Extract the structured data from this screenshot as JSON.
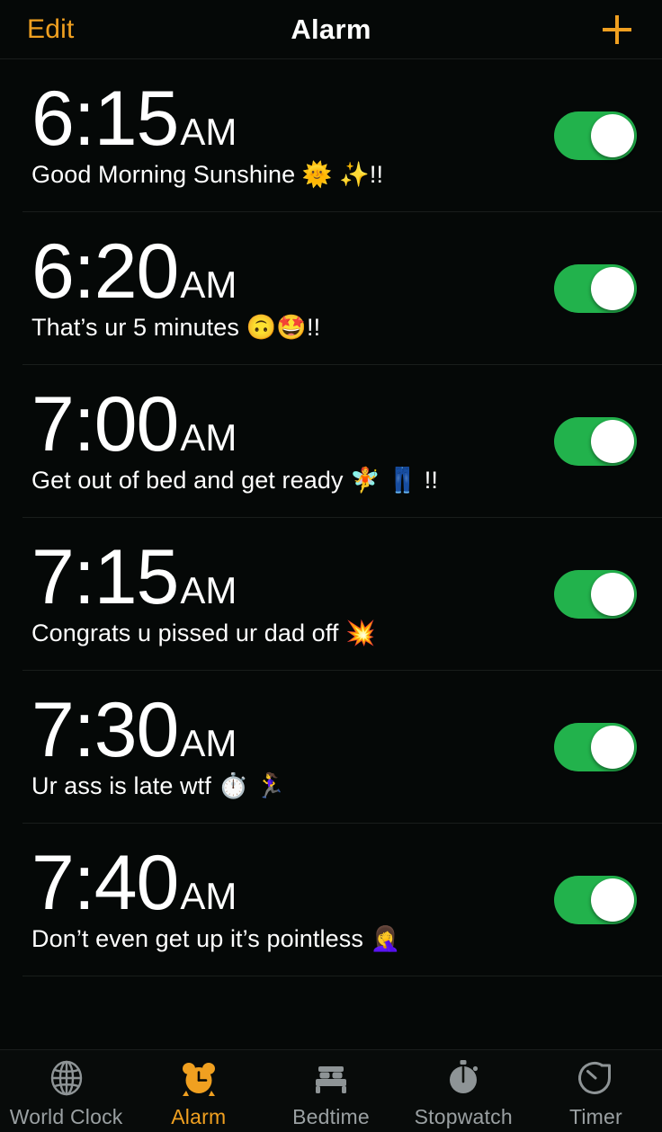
{
  "app": {
    "screen_title": "Alarm",
    "background_color": "#050807",
    "accent_color": "#F0A020",
    "toggle_on_color": "#22B24C"
  },
  "nav": {
    "edit_label": "Edit",
    "title": "Alarm",
    "add_icon": "plus-icon"
  },
  "alarms": [
    {
      "time": "6:15",
      "period": "AM",
      "label": "Good Morning Sunshine 🌞 ✨!!",
      "enabled": true,
      "toggle_state": "on"
    },
    {
      "time": "6:20",
      "period": "AM",
      "label": "That’s ur 5 minutes 🙃🤩!!",
      "enabled": true,
      "toggle_state": "on"
    },
    {
      "time": "7:00",
      "period": "AM",
      "label": "Get out of bed and get ready 🧚 👖 !!",
      "enabled": true,
      "toggle_state": "on"
    },
    {
      "time": "7:15",
      "period": "AM",
      "label": "Congrats u pissed ur dad off 💥",
      "enabled": true,
      "toggle_state": "on"
    },
    {
      "time": "7:30",
      "period": "AM",
      "label": "Ur ass is late wtf ⏱️ 🏃‍♀️",
      "enabled": true,
      "toggle_state": "on"
    },
    {
      "time": "7:40",
      "period": "AM",
      "label": "Don’t even get up it’s pointless 🤦‍♀️",
      "enabled": true,
      "toggle_state": "on"
    }
  ],
  "tab_bar": {
    "active_tab": "Alarm",
    "items": [
      {
        "label": "World Clock",
        "icon": "globe-icon",
        "active": false
      },
      {
        "label": "Alarm",
        "icon": "alarm-clock-icon",
        "active": true
      },
      {
        "label": "Bedtime",
        "icon": "bed-icon",
        "active": false
      },
      {
        "label": "Stopwatch",
        "icon": "stopwatch-icon",
        "active": false
      },
      {
        "label": "Timer",
        "icon": "timer-icon",
        "active": false
      }
    ]
  }
}
